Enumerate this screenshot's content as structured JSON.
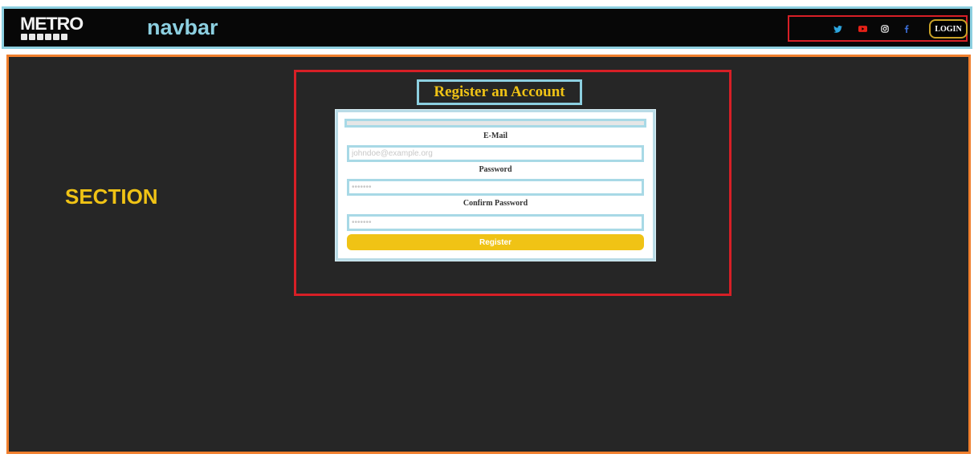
{
  "navbar": {
    "logo_text": "METRO",
    "title": "navbar",
    "social": [
      {
        "icon": "twitter-icon",
        "color": "#2da7e0"
      },
      {
        "icon": "youtube-icon",
        "color": "#e62117"
      },
      {
        "icon": "instagram-icon",
        "color": "#e8e8e8"
      },
      {
        "icon": "facebook-icon",
        "color": "#3b6ed8"
      }
    ],
    "login_label": "LOGIN"
  },
  "section": {
    "label": "SECTION",
    "register": {
      "title": "Register an Account",
      "email_label": "E-Mail",
      "email_placeholder": "johndoe@example.org",
      "password_label": "Password",
      "password_placeholder": "•••••••",
      "confirm_label": "Confirm Password",
      "confirm_placeholder": "•••••••",
      "button_label": "Register"
    }
  },
  "colors": {
    "accent": "#f0c315",
    "outline_blue": "#8ccfe0",
    "outline_red": "#d71f26",
    "outline_orange": "#f07f2d",
    "navbar_bg": "#070707",
    "section_bg": "#262626"
  }
}
